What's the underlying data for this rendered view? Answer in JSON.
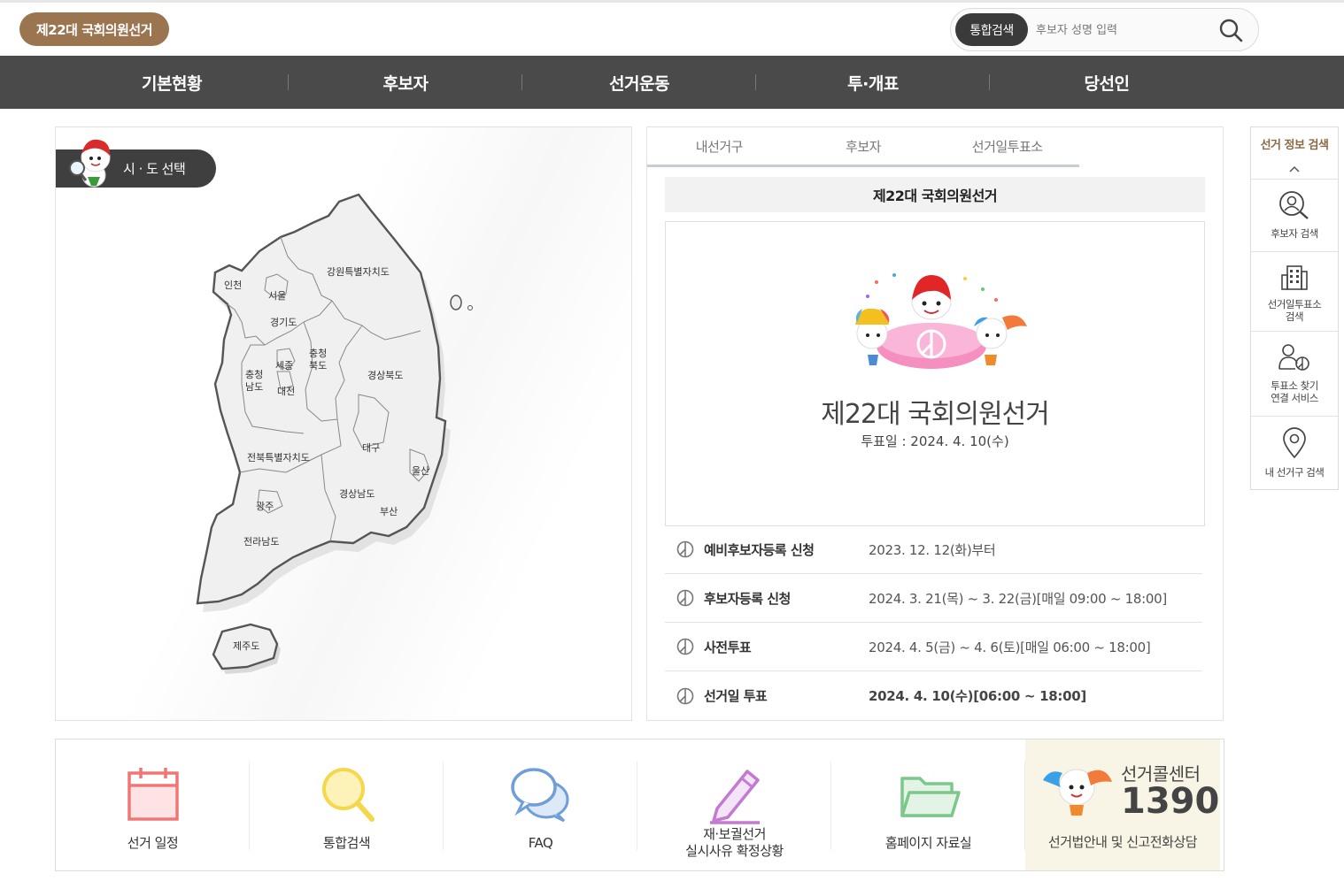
{
  "header": {
    "badge": "제22대 국회의원선거",
    "search_type": "통합검색",
    "search_placeholder": "후보자 성명 입력"
  },
  "gnb": [
    "기본현황",
    "후보자",
    "선거운동",
    "투·개표",
    "당선인"
  ],
  "map": {
    "tab_label": "시 · 도 선택",
    "regions": {
      "incheon": "인천",
      "seoul": "서울",
      "gyeonggi": "경기도",
      "gangwon": "강원특별자치도",
      "chungnam": "충청\n남도",
      "chungnam_1": "충청",
      "chungnam_2": "남도",
      "sejong": "세종",
      "chungbuk_1": "충청",
      "chungbuk_2": "북도",
      "daejeon": "대전",
      "gyeongbuk": "경상북도",
      "daegu": "대구",
      "jeonbuk": "전북특별자치도",
      "ulsan": "울산",
      "gwangju": "광주",
      "gyeongnam": "경상남도",
      "busan": "부산",
      "jeonnam": "전라남도",
      "jeju": "제주도"
    }
  },
  "info": {
    "tabs": [
      "내선거구",
      "후보자",
      "선거일투표소"
    ],
    "title": "제22대 국회의원선거",
    "banner_title": "제22대 국회의원선거",
    "banner_date": "투표일 : 2024. 4. 10(수)",
    "schedule": [
      {
        "label": "예비후보자등록 신청",
        "date": "2023. 12. 12(화)부터"
      },
      {
        "label": "후보자등록 신청",
        "date": "2024. 3. 21(목) ~ 3. 22(금)[매일 09:00 ~ 18:00]"
      },
      {
        "label": "사전투표",
        "date": "2024. 4. 5(금) ~ 4. 6(토)[매일 06:00 ~ 18:00]"
      },
      {
        "label": "선거일 투표",
        "date": "2024. 4. 10(수)[06:00 ~ 18:00]"
      }
    ]
  },
  "quick": {
    "title": "선거 정보 검색",
    "items": [
      {
        "icon": "person-search-icon",
        "label": "후보자 검색"
      },
      {
        "icon": "building-icon",
        "label": "선거일투표소\n검색"
      },
      {
        "icon": "person-pie-icon",
        "label": "투표소 찾기\n연결 서비스"
      },
      {
        "icon": "location-pin-icon",
        "label": "내 선거구 검색"
      }
    ]
  },
  "bottom": {
    "items": [
      {
        "icon": "calendar-icon",
        "label": "선거 일정"
      },
      {
        "icon": "magnifier-icon",
        "label": "통합검색"
      },
      {
        "icon": "chat-bubbles-icon",
        "label": "FAQ"
      },
      {
        "icon": "pencil-icon",
        "label": "재·보궐선거\n실시사유 확정상황"
      },
      {
        "icon": "folder-icon",
        "label": "홈페이지 자료실"
      }
    ],
    "call": {
      "title": "선거콜센터",
      "number": "1390",
      "desc": "선거법안내 및 신고전화상담"
    }
  },
  "colors": {
    "brand": "#9a7550",
    "gnb_bg": "#4a4a4a",
    "quick_title": "#8a6a46",
    "calendar": "#f07676",
    "magnifier": "#f5d74a",
    "chat": "#6f9ed8",
    "pencil": "#c37bd1",
    "folder": "#7cc78a"
  }
}
